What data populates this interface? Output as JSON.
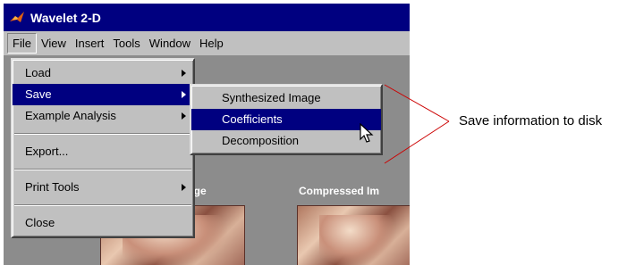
{
  "window": {
    "title": "Wavelet 2-D"
  },
  "menubar": {
    "items": [
      {
        "label": "File"
      },
      {
        "label": "View"
      },
      {
        "label": "Insert"
      },
      {
        "label": "Tools"
      },
      {
        "label": "Window"
      },
      {
        "label": "Help"
      }
    ]
  },
  "file_menu": {
    "load": "Load",
    "save": "Save",
    "example_analysis": "Example Analysis",
    "export": "Export...",
    "print_tools": "Print Tools",
    "close": "Close"
  },
  "save_submenu": {
    "synthesized_image": "Synthesized Image",
    "coefficients": "Coefficients",
    "decomposition": "Decomposition"
  },
  "figure": {
    "original_label_partial": "age",
    "compressed_label_partial": "Compressed Im"
  },
  "annotation": {
    "text": "Save information to disk"
  },
  "colors": {
    "titlebar": "#000080",
    "selection": "#000080",
    "callout_line": "#cc0000"
  }
}
